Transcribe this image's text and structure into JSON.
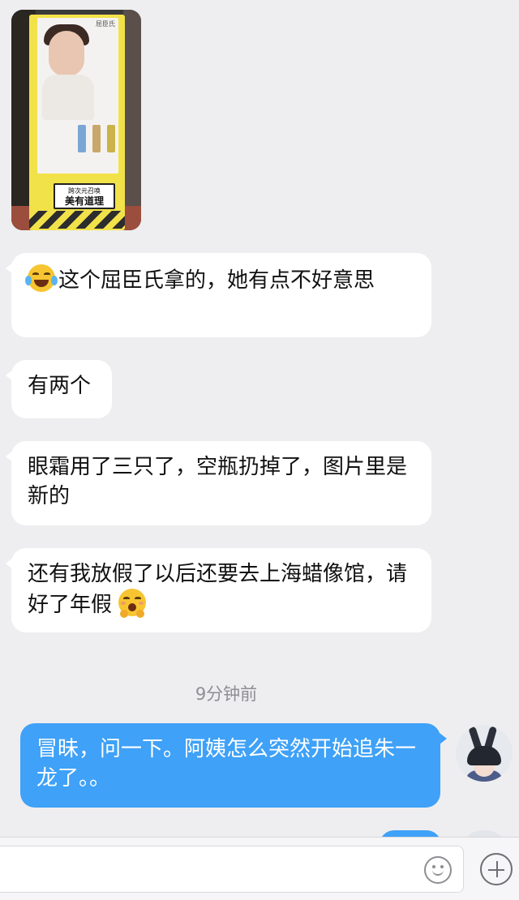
{
  "photo": {
    "alt_label": "",
    "store_label": "屈臣氏",
    "sign_small": "跨次元召唤",
    "sign_big": "美有道理"
  },
  "messages": [
    {
      "direction": "incoming",
      "emoji": "face-with-tears-of-joy-icon",
      "text": "这个屈臣氏拿的，她有点不好意思"
    },
    {
      "direction": "incoming",
      "text": "有两个"
    },
    {
      "direction": "incoming",
      "text": "眼霜用了三只了，空瓶扔掉了，图片里是新的"
    },
    {
      "direction": "incoming",
      "text": "还有我放假了以后还要去上海蜡像馆，请好了年假",
      "emoji_after": "hugging-face-icon"
    }
  ],
  "timestamp": "9分钟前",
  "outgoing": {
    "text": "冒昧，问一下。阿姨怎么突然开始追朱一龙了。。"
  },
  "input": {
    "placeholder": ""
  },
  "colors": {
    "background": "#eeeef0",
    "incoming_bubble": "#ffffff",
    "outgoing_bubble": "#3fa1f7"
  }
}
